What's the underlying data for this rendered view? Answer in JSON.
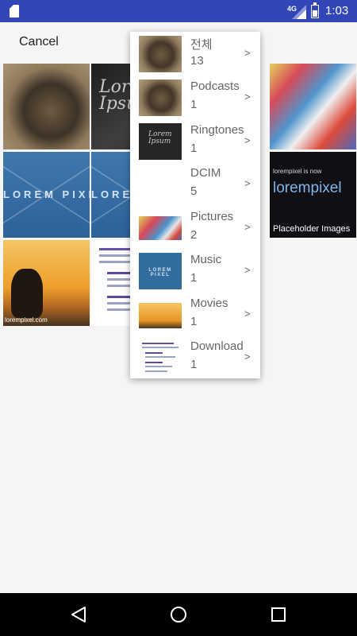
{
  "status_bar": {
    "network": "4G",
    "time": "1:03"
  },
  "top_bar": {
    "cancel_label": "Cancel"
  },
  "grid": {
    "lorem_text": "Lorem\nIpsum",
    "lorem_pixel_text": "LOREM PIXEL",
    "pixel_tile": {
      "top_text": "lorempixel is now",
      "main_text": "lorempixel",
      "bottom_text": "Placeholder Images"
    },
    "sunset_caption": "lorempixel.com"
  },
  "album_menu": {
    "items": [
      {
        "name": "전체",
        "count": "13",
        "arrow": ">",
        "thumb": "cat"
      },
      {
        "name": "Podcasts",
        "count": "1",
        "arrow": ">",
        "thumb": "cat"
      },
      {
        "name": "Ringtones",
        "count": "1",
        "arrow": ">",
        "thumb": "lorem-ipsum"
      },
      {
        "name": "DCIM",
        "count": "5",
        "arrow": ">",
        "thumb": "none"
      },
      {
        "name": "Pictures",
        "count": "2",
        "arrow": ">",
        "thumb": "colorful"
      },
      {
        "name": "Music",
        "count": "1",
        "arrow": ">",
        "thumb": "lorem-pixel"
      },
      {
        "name": "Movies",
        "count": "1",
        "arrow": ">",
        "thumb": "sunset"
      },
      {
        "name": "Download",
        "count": "1",
        "arrow": ">",
        "thumb": "document"
      }
    ],
    "thumb_texts": {
      "lorem": "Lorem\nIpsum",
      "pixel": "LOREM PIXEL"
    }
  },
  "colors": {
    "status_bar": "#3346b8",
    "background": "#f5f5f5",
    "nav_bar": "#000000"
  },
  "icons": [
    "sd-card-icon",
    "signal-icon",
    "battery-icon",
    "back-icon",
    "home-icon",
    "recents-icon"
  ]
}
